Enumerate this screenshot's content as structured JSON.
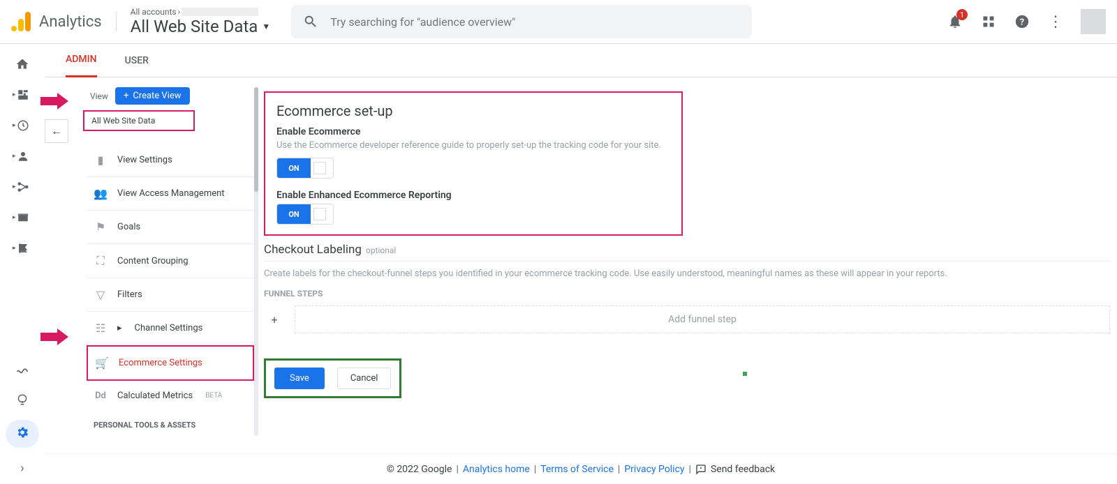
{
  "header": {
    "product": "Analytics",
    "acc_label": "All accounts",
    "view_name": "All Web Site Data",
    "search_placeholder": "Try searching for \"audience overview\"",
    "notif_count": "1"
  },
  "tabs": {
    "admin": "ADMIN",
    "user": "USER"
  },
  "viewcol": {
    "label": "View",
    "create": "Create View",
    "selector": "All Web Site Data",
    "items": {
      "settings": "View Settings",
      "access": "View Access Management",
      "goals": "Goals",
      "grouping": "Content Grouping",
      "filters": "Filters",
      "channel": "Channel Settings",
      "ecommerce": "Ecommerce Settings",
      "calculated": "Calculated Metrics",
      "beta": "BETA"
    },
    "personal": "PERSONAL TOOLS & ASSETS"
  },
  "main": {
    "title": "Ecommerce set-up",
    "enable_label": "Enable Ecommerce",
    "enable_desc": "Use the Ecommerce developer reference guide to properly set-up the tracking code for your site.",
    "toggle_on": "ON",
    "enhanced_label": "Enable Enhanced Ecommerce Reporting",
    "checkout_title": "Checkout Labeling",
    "checkout_opt": "optional",
    "checkout_desc": "Create labels for the checkout-funnel steps you identified in your ecommerce tracking code. Use easily understood, meaningful names as these will appear in your reports.",
    "funnel": "FUNNEL STEPS",
    "add_step": "Add funnel step",
    "save": "Save",
    "cancel": "Cancel"
  },
  "footer": {
    "copyright": "© 2022 Google",
    "home": "Analytics home",
    "terms": "Terms of Service",
    "privacy": "Privacy Policy",
    "feedback": "Send feedback"
  }
}
